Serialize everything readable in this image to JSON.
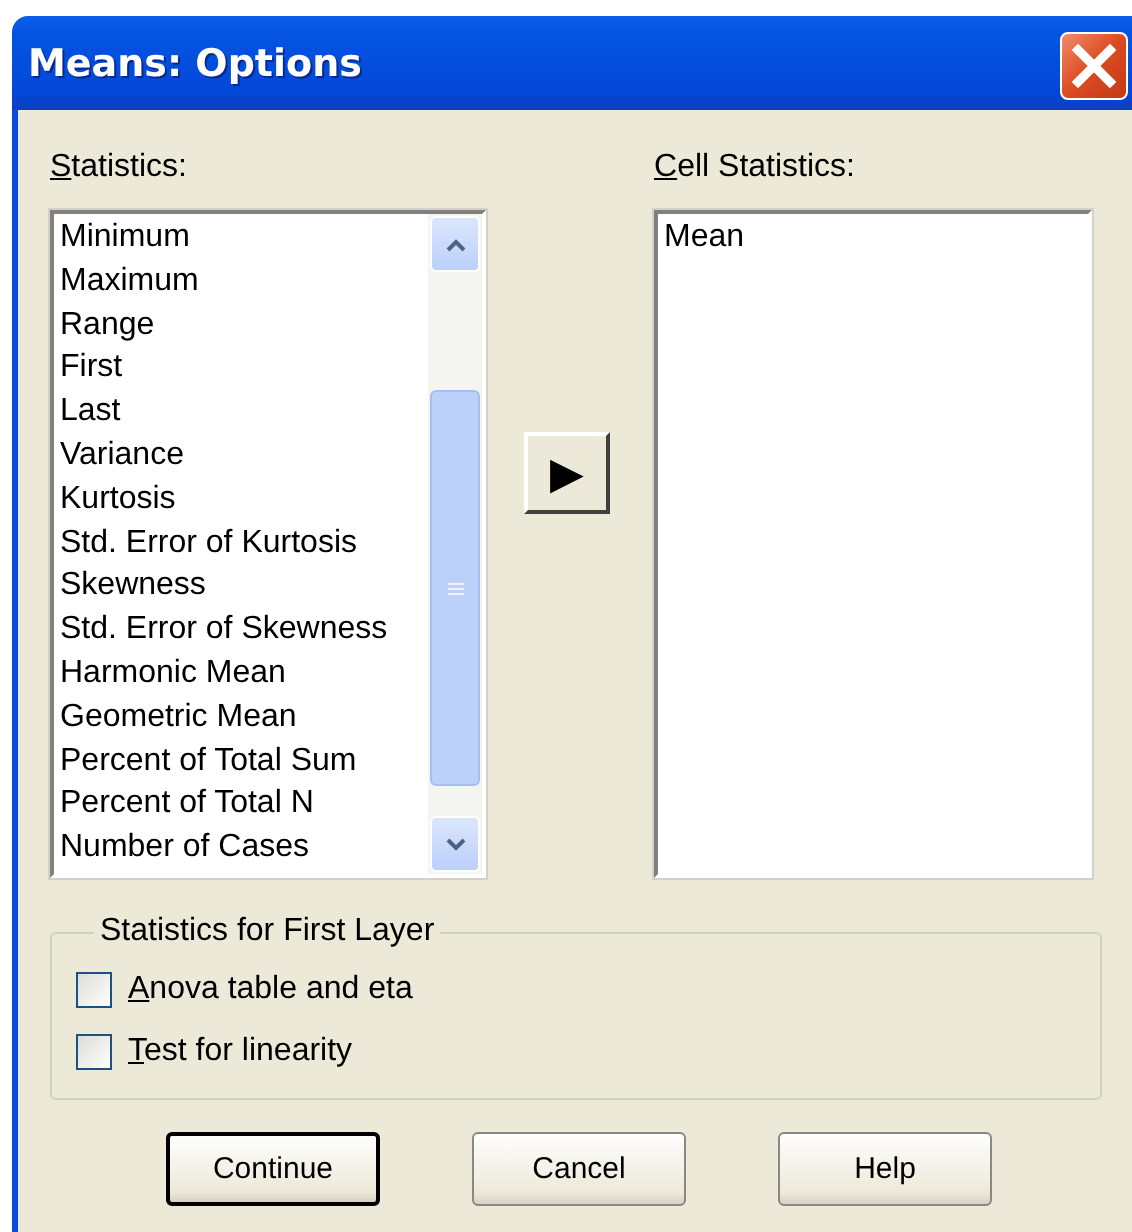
{
  "window": {
    "title": "Means: Options"
  },
  "statistics": {
    "label": "Statistics:",
    "first_letter_underlined": true,
    "items": [
      "Minimum",
      "Maximum",
      "Range",
      "First",
      "Last",
      "Variance",
      "Kurtosis",
      "Std. Error of Kurtosis",
      "Skewness",
      "Std. Error of Skewness",
      "Harmonic Mean",
      "Geometric Mean",
      "Percent of Total Sum",
      "Percent of Total N",
      "Number of Cases"
    ]
  },
  "move_button": {
    "label": "▶"
  },
  "cell_statistics": {
    "label": "Cell Statistics:",
    "first_letter_underlined": true,
    "items": [
      "Mean"
    ]
  },
  "first_layer": {
    "title": "Statistics for First Layer",
    "options": [
      {
        "label": "Anova table and eta",
        "first_letter_underlined": true,
        "checked": false
      },
      {
        "label": "Test for linearity",
        "first_letter_underlined": true,
        "checked": false
      }
    ]
  },
  "buttons": [
    {
      "label": "Continue",
      "default": true
    },
    {
      "label": "Cancel",
      "default": false
    },
    {
      "label": "Help",
      "default": false
    }
  ]
}
